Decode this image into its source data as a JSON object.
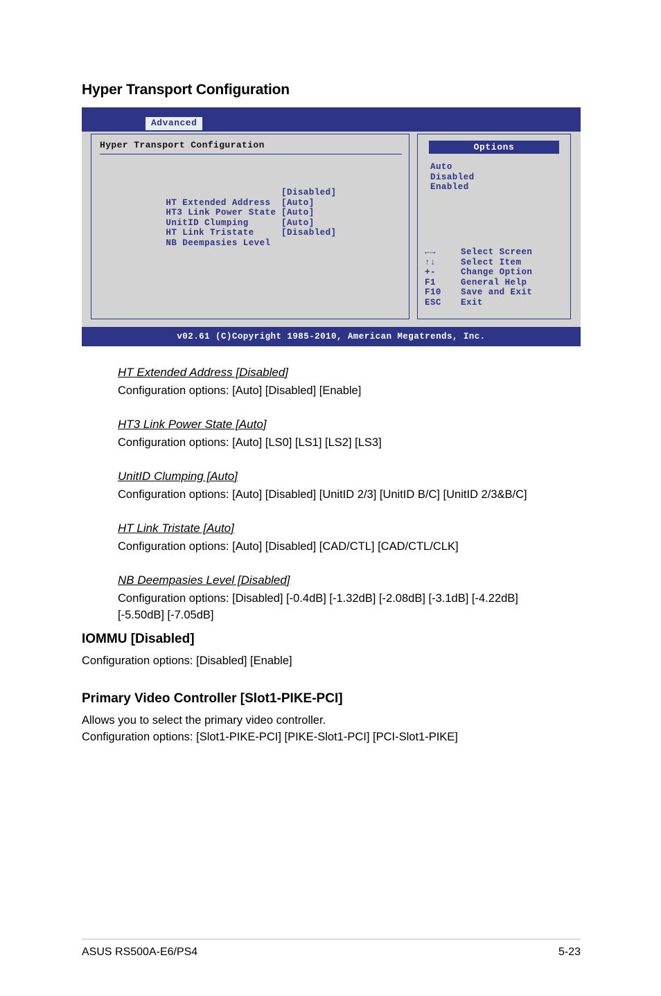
{
  "section": {
    "title": "Hyper Transport Configuration"
  },
  "colors": {
    "bios_blue": "#2e3587",
    "bios_gray": "#d3d3d3",
    "bios_white": "#ffffff"
  },
  "bios": {
    "tab_label": "Advanced",
    "panel_heading": "Hyper Transport Configuration",
    "menu_items": [
      {
        "label": "HT Extended Address",
        "value": "[Disabled]"
      },
      {
        "label": "HT3 Link Power State",
        "value": "[Auto]"
      },
      {
        "label": "UnitID Clumping",
        "value": "[Auto]"
      },
      {
        "label": "HT Link Tristate",
        "value": "[Auto]"
      },
      {
        "label": "NB Deempasies Level",
        "value": "[Disabled]"
      }
    ],
    "options": {
      "title": "Options",
      "values": [
        "Auto",
        "Disabled",
        "Enabled"
      ]
    },
    "legend": [
      {
        "key": "←→",
        "action": "Select Screen"
      },
      {
        "key": "↑↓",
        "action": "Select Item"
      },
      {
        "key": "+-",
        "action": "Change Option"
      },
      {
        "key": "F1",
        "action": "General Help"
      },
      {
        "key": "F10",
        "action": "Save and Exit"
      },
      {
        "key": "ESC",
        "action": "Exit"
      }
    ],
    "footer": "v02.61 (C)Copyright 1985-2010, American Megatrends, Inc."
  },
  "descriptions": [
    {
      "title": "HT Extended Address [Disabled]",
      "desc": "Configuration options: [Auto] [Disabled] [Enable]"
    },
    {
      "title": "HT3 Link Power State [Auto]",
      "desc": "Configuration options: [Auto] [LS0] [LS1] [LS2] [LS3]"
    },
    {
      "title": "UnitID Clumping [Auto]",
      "desc": "Configuration options: [Auto] [Disabled] [UnitID 2/3] [UnitID B/C] [UnitID 2/3&B/C]"
    },
    {
      "title": "HT Link Tristate [Auto]",
      "desc": "Configuration options: [Auto] [Disabled] [CAD/CTL] [CAD/CTL/CLK]"
    },
    {
      "title": "NB Deempasies Level [Disabled]",
      "desc": "Configuration options: [Disabled] [-0.4dB] [-1.32dB] [-2.08dB] [-3.1dB] [-4.22dB] [-5.50dB] [-7.05dB]"
    }
  ],
  "blocks": [
    {
      "title": "IOMMU [Disabled]",
      "desc": "Configuration options: [Disabled] [Enable]"
    },
    {
      "title": "Primary Video Controller [Slot1-PIKE-PCI]",
      "desc": "Allows you to select the primary video controller.\nConfiguration options: [Slot1-PIKE-PCI] [PIKE-Slot1-PCI] [PCI-Slot1-PIKE]"
    }
  ],
  "page_footer": {
    "product": "ASUS RS500A-E6/PS4",
    "page_number": "5-23"
  }
}
